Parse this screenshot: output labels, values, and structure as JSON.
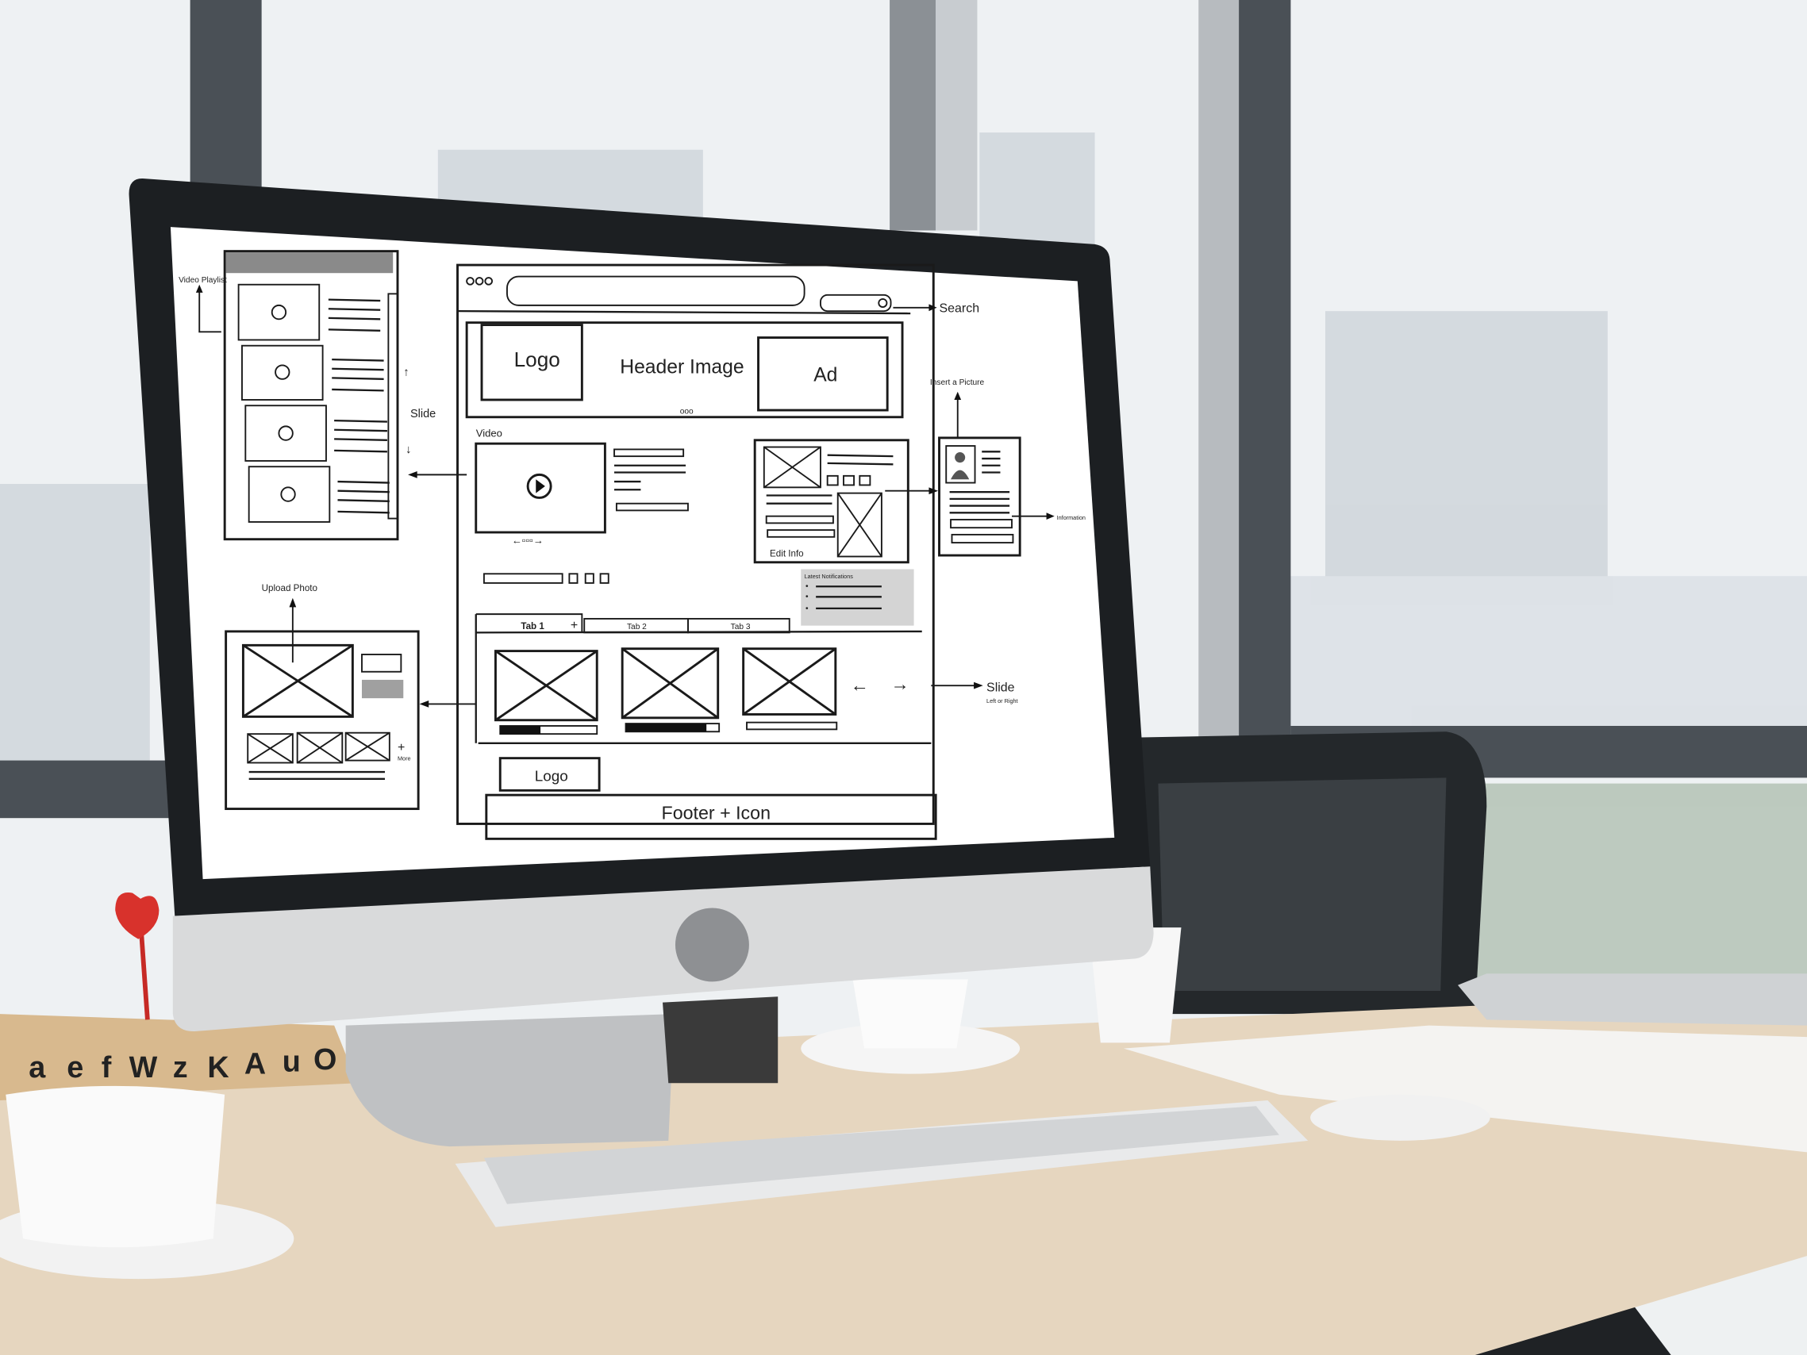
{
  "colors": {
    "sky": "#eef1f2",
    "window_frame": "#3a3f44",
    "desk": "#e6d6bf",
    "bezel": "#1c1f22",
    "chin": "#d9dadb",
    "screen": "#ffffff",
    "wire": "#1a1a1a",
    "wire_fill_gray": "#d4d4d4",
    "dart": "#d8322c"
  },
  "wireframe": {
    "playlist": {
      "label": "Video Playlist",
      "slide_label": "Slide",
      "up_arrow": "↑",
      "down_arrow": "↓"
    },
    "browser": {
      "search_label": "Search",
      "header": {
        "logo": "Logo",
        "header_image": "Header Image",
        "ad": "Ad",
        "pager": "ooo"
      },
      "video_label": "Video",
      "video_pager": "←▫▫▫→",
      "edit_info": "Edit Info",
      "notifications": {
        "title": "Latest Notifications",
        "bullet": "•"
      },
      "tabs": [
        {
          "label": "Tab 1"
        },
        {
          "label": "Tab 2"
        },
        {
          "label": "Tab 3"
        }
      ],
      "tab_add": "+",
      "slider_arrows": {
        "left": "←",
        "right": "→"
      },
      "footer_logo": "Logo",
      "footer": "Footer + Icon"
    },
    "profile": {
      "insert_picture": "Insert a Picture",
      "information": "Information"
    },
    "slide_note": {
      "title": "Slide",
      "subtitle": "Left or Right"
    },
    "upload": {
      "label": "Upload Photo",
      "more_plus": "+",
      "more": "More"
    }
  },
  "desk_blocks": [
    "a",
    "e",
    "f",
    "W",
    "z",
    "K",
    "A",
    "u",
    "O"
  ]
}
